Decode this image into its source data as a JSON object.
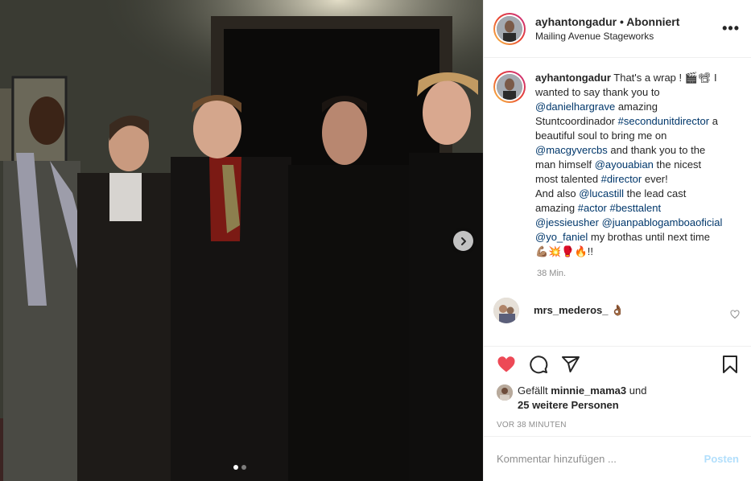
{
  "post": {
    "username": "ayhantongadur",
    "separator": "•",
    "follow_status": "Abonniert",
    "location": "Mailing Avenue Stageworks",
    "more_label": "•••"
  },
  "caption": {
    "username": "ayhantongadur",
    "segments": [
      {
        "t": " That's a wrap ! 🎬📽",
        "link": false
      },
      {
        "t": " I wanted to say thank you to ",
        "link": false
      },
      {
        "t": "@danielhargrave",
        "link": true
      },
      {
        "t": " amazing Stuntcoordinador ",
        "link": false
      },
      {
        "t": "#secondunitdirector",
        "link": true
      },
      {
        "t": " a beautiful soul to bring me on ",
        "link": false
      },
      {
        "t": "@macgyvercbs",
        "link": true
      },
      {
        "t": " and thank you to the man himself ",
        "link": false
      },
      {
        "t": "@ayouabian",
        "link": true
      },
      {
        "t": " the nicest most talented ",
        "link": false
      },
      {
        "t": "#director",
        "link": true
      },
      {
        "t": " ever!",
        "link": false
      }
    ],
    "line2_segments": [
      {
        "t": "And also ",
        "link": false
      },
      {
        "t": "@lucastill",
        "link": true
      },
      {
        "t": " the lead cast amazing ",
        "link": false
      },
      {
        "t": "#actor",
        "link": true
      },
      {
        "t": " ",
        "link": false
      },
      {
        "t": "#besttalent",
        "link": true
      },
      {
        "t": " ",
        "link": false
      },
      {
        "t": "@jessieusher",
        "link": true
      },
      {
        "t": " ",
        "link": false
      },
      {
        "t": "@juanpablogamboaoficial",
        "link": true
      },
      {
        "t": " ",
        "link": false
      },
      {
        "t": "@yo_faniel",
        "link": true
      },
      {
        "t": " my brothas until next time 💪🏽💥🥊🔥!!",
        "link": false
      }
    ],
    "time": "38 Min."
  },
  "comment": {
    "username": "mrs_mederos_",
    "text": "👌🏾"
  },
  "likes": {
    "prefix": "Gefällt ",
    "liker": "minnie_mama3",
    "middle": " und",
    "others": "25 weitere Personen"
  },
  "ago": "VOR 38 MINUTEN",
  "add_comment": {
    "placeholder": "Kommentar hinzufügen ...",
    "post_label": "Posten"
  },
  "carousel": {
    "current": 1,
    "total": 2
  },
  "colors": {
    "link": "#00376b",
    "like_red": "#ed4956",
    "post_disabled": "#b2dffc",
    "meta_gray": "#8e8e8e"
  },
  "icons": {
    "like": "heart-icon",
    "comment": "comment-bubble-icon",
    "share": "paper-plane-icon",
    "save": "bookmark-icon",
    "next": "chevron-right-icon",
    "more": "more-dots-icon",
    "comment_like": "small-heart-icon"
  }
}
